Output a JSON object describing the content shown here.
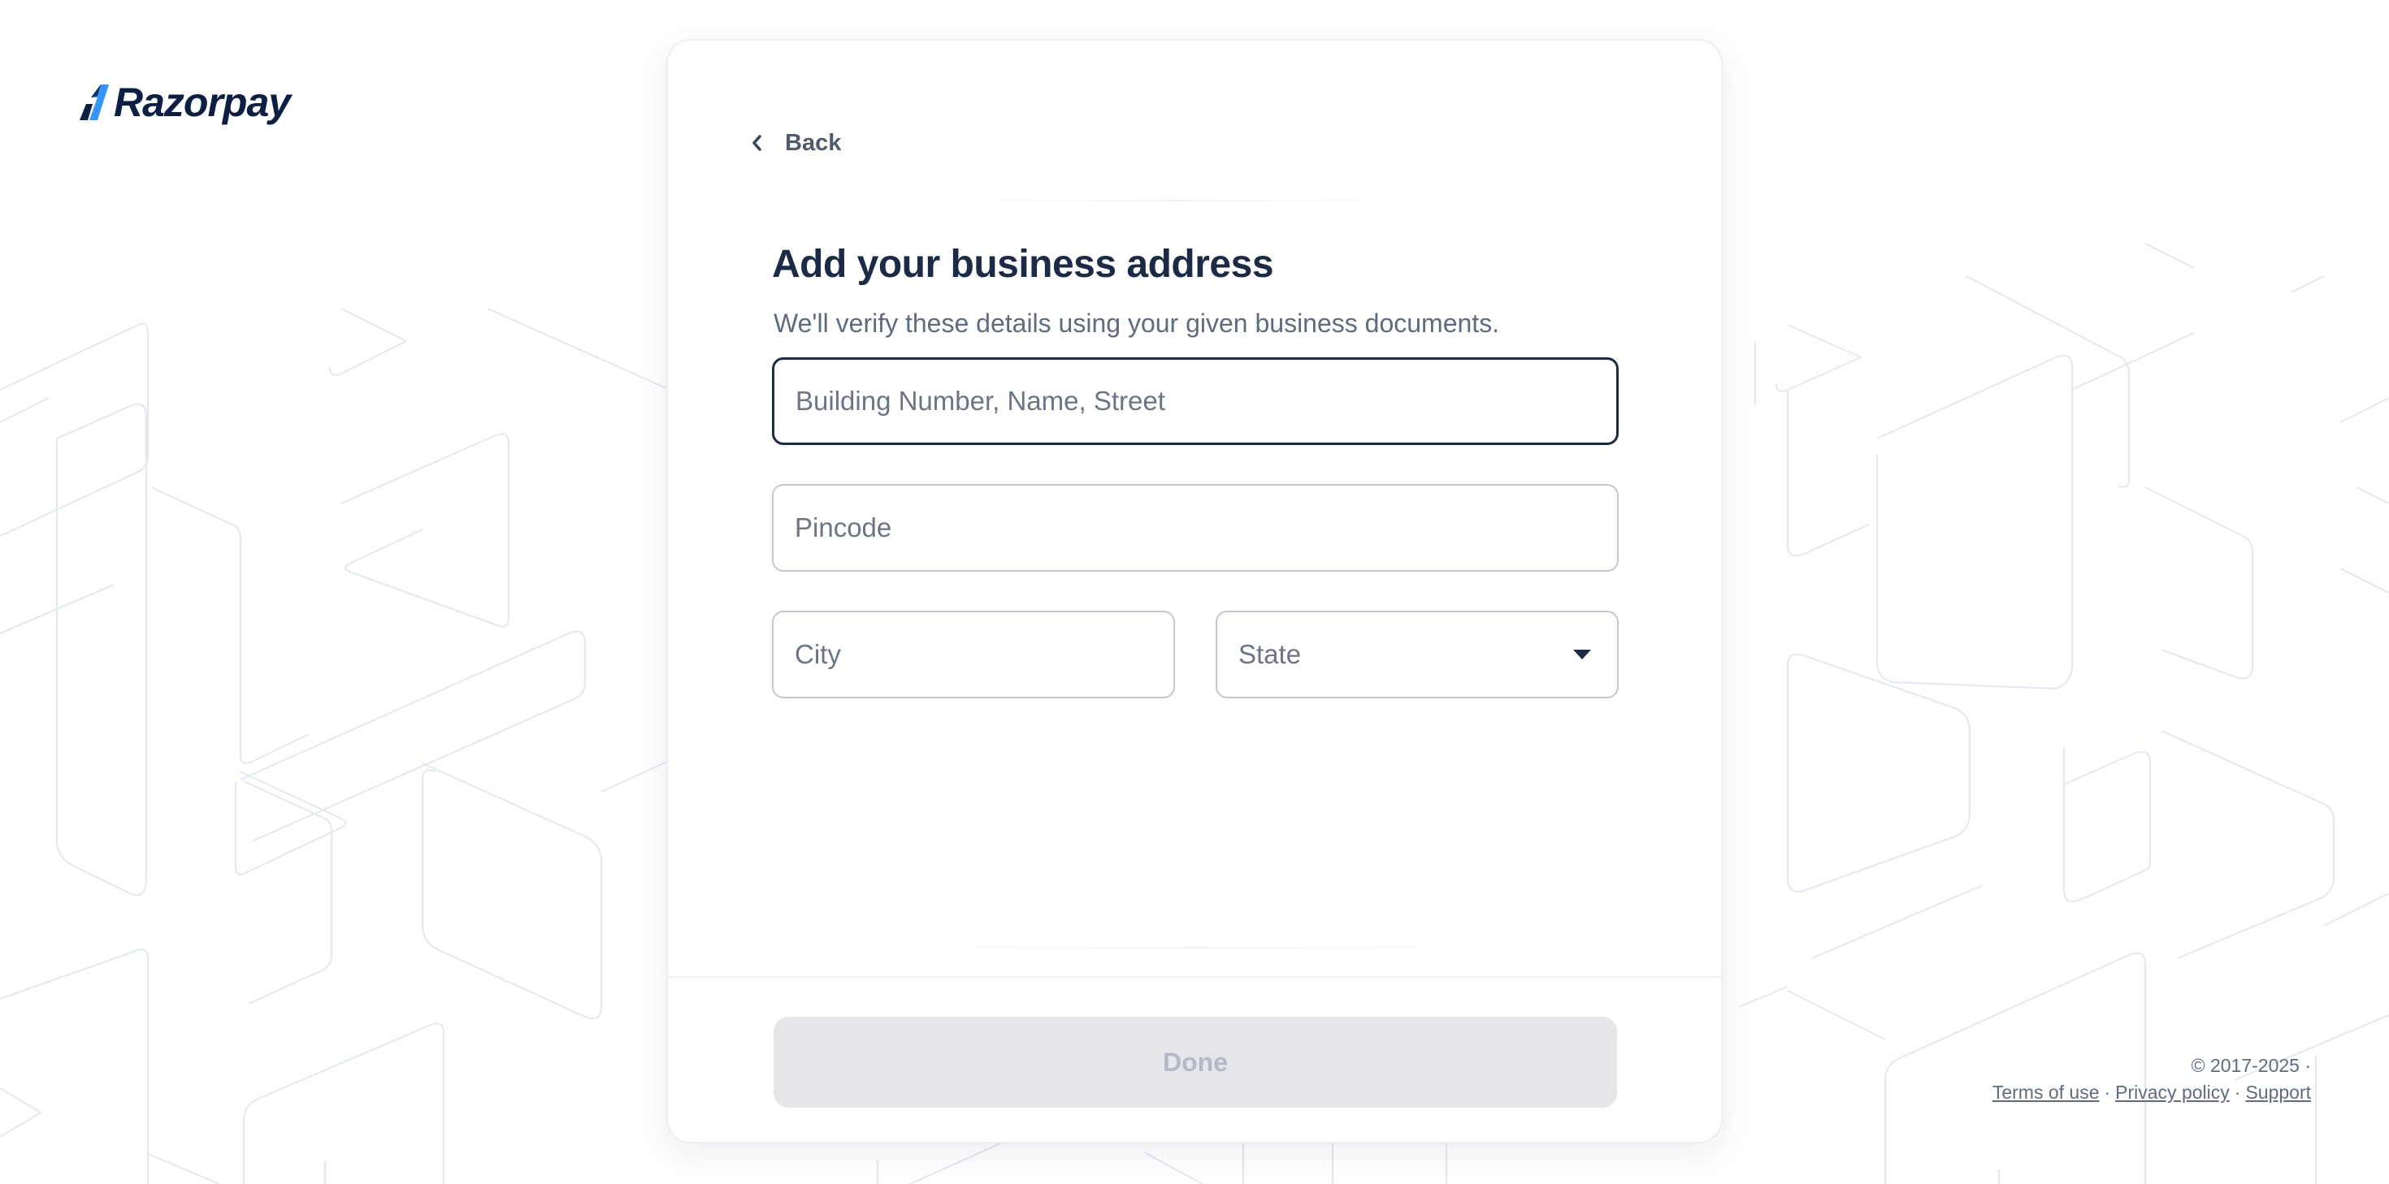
{
  "brand": {
    "name": "Razorpay",
    "logo_icon": "razorpay-logo-icon",
    "color": "#0b1f44",
    "accent": "#3395ff"
  },
  "nav": {
    "back_label": "Back"
  },
  "form": {
    "title": "Add your business address",
    "subtitle": "We'll verify these details using your given business documents.",
    "street_placeholder": "Building Number, Name, Street",
    "street_value": "",
    "pincode_placeholder": "Pincode",
    "pincode_value": "",
    "city_placeholder": "City",
    "city_value": "",
    "state_label": "State",
    "done_label": "Done"
  },
  "footer": {
    "copyright": "© 2017-2025 ·",
    "terms_label": "Terms of use",
    "privacy_label": "Privacy policy",
    "support_label": "Support",
    "separator": "·"
  },
  "colors": {
    "title": "#1b2a47",
    "muted": "#5e6b80",
    "pattern_stroke": "#dfe7f4",
    "button_disabled_bg": "#e4e6ea",
    "button_disabled_text": "#b4bac5"
  }
}
